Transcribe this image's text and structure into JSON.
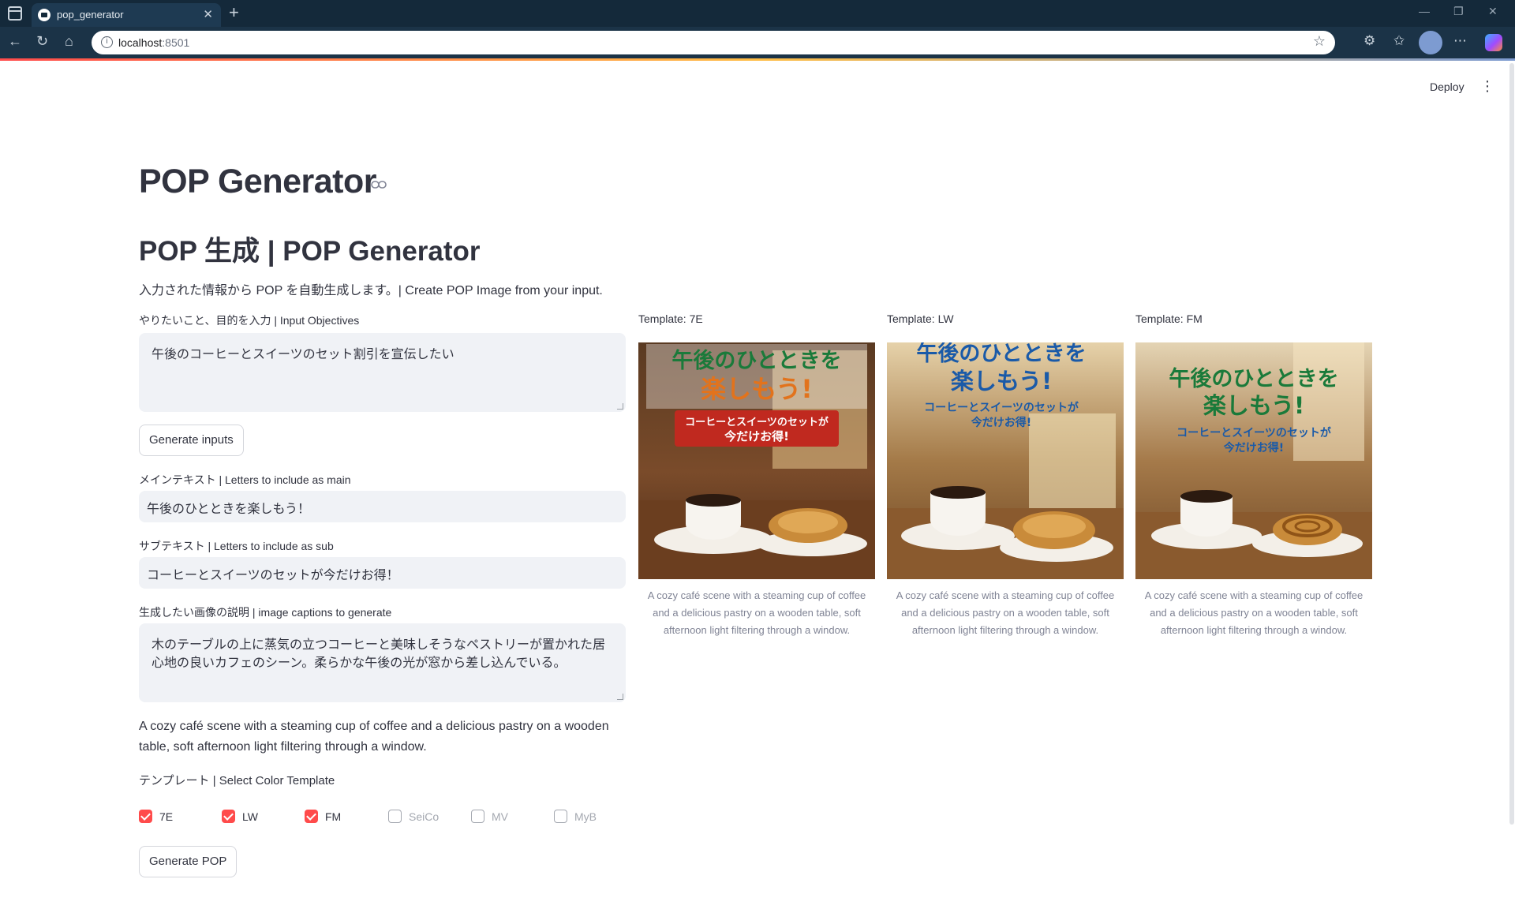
{
  "browser": {
    "tab_title": "pop_generator",
    "url_host": "localhost",
    "url_port": ":8501"
  },
  "header": {
    "deploy_label": "Deploy"
  },
  "page": {
    "title": "POP Generator",
    "subtitle": "POP 生成 | POP Generator",
    "description": "入力された情報から POP を自動生成します。| Create POP Image from your input."
  },
  "form": {
    "objective_label": "やりたいこと、目的を入力 | Input Objectives",
    "objective_value": "午後のコーヒーとスイーツのセット割引を宣伝したい",
    "generate_inputs_label": "Generate inputs",
    "main_text_label": "メインテキスト | Letters to include as main",
    "main_text_value": "午後のひとときを楽しもう！",
    "sub_text_label": "サブテキスト | Letters to include as sub",
    "sub_text_value": "コーヒーとスイーツのセットが今だけお得！",
    "image_desc_label": "生成したい画像の説明 | image captions to generate",
    "image_desc_value": "木のテーブルの上に蒸気の立つコーヒーと美味しそうなペストリーが置かれた居心地の良いカフェのシーン。柔らかな午後の光が窓から差し込んでいる。",
    "english_caption": "A cozy café scene with a steaming cup of coffee and a delicious pastry on a wooden table, soft afternoon light filtering through a window.",
    "template_label": "テンプレート | Select Color Template",
    "templates": [
      {
        "label": "7E",
        "checked": true
      },
      {
        "label": "LW",
        "checked": true
      },
      {
        "label": "FM",
        "checked": true
      },
      {
        "label": "SeiCo",
        "checked": false
      },
      {
        "label": "MV",
        "checked": false
      },
      {
        "label": "MyB",
        "checked": false
      }
    ],
    "generate_pop_label": "Generate POP"
  },
  "results": [
    {
      "label": "Template: 7E",
      "headline_1": "午後のひとときを",
      "headline_2": "楽しもう!",
      "sub_1": "コーヒーとスイーツのセットが",
      "sub_2": "今だけお得!",
      "caption": "A cozy café scene with a steaming cup of coffee and a delicious pastry on a wooden table, soft afternoon light filtering through a window."
    },
    {
      "label": "Template: LW",
      "headline_1": "午後のひとときを",
      "headline_2": "楽しもう!",
      "sub_1": "コーヒーとスイーツのセットが",
      "sub_2": "今だけお得!",
      "caption": "A cozy café scene with a steaming cup of coffee and a delicious pastry on a wooden table, soft afternoon light filtering through a window."
    },
    {
      "label": "Template: FM",
      "headline_1": "午後のひとときを",
      "headline_2": "楽しもう!",
      "sub_1": "コーヒーとスイーツのセットが",
      "sub_2": "今だけお得!",
      "caption": "A cozy café scene with a steaming cup of coffee and a delicious pastry on a wooden table, soft afternoon light filtering through a window."
    }
  ],
  "colors": {
    "accent": "#ff4b4b",
    "green_headline": "#1a7a3a",
    "orange_headline": "#e2731c",
    "blue_headline": "#1a5aa8",
    "red_badge": "#c0291f"
  }
}
